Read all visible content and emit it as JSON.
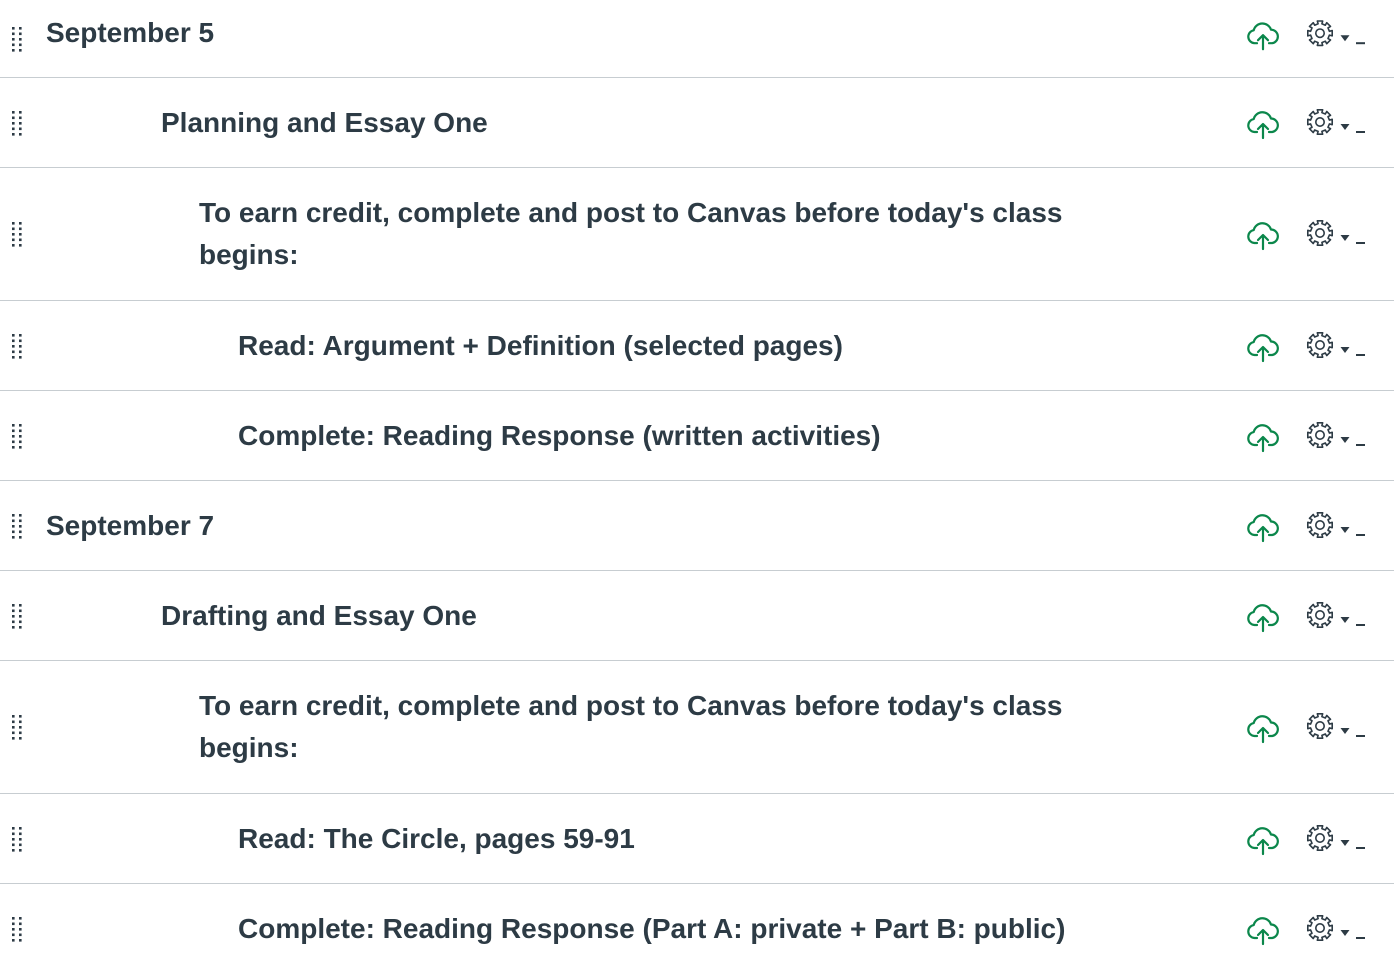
{
  "theme": {
    "text_color": "#2d3b45",
    "published_color": "#0b874b",
    "divider_color": "#c7cdd1"
  },
  "icons": {
    "handle": "drag-handle-icon",
    "publish": "cloud-upload-icon",
    "settings": "gear-icon",
    "menu": "caret-down-icon"
  },
  "items": [
    {
      "title": "September 5",
      "level": 0,
      "published": true
    },
    {
      "title": "Planning and Essay One",
      "level": 1,
      "published": true
    },
    {
      "title": "To earn credit, complete and post to Canvas before today's class begins:",
      "level": 2,
      "published": true
    },
    {
      "title": "Read: Argument + Definition (selected pages)",
      "level": 3,
      "published": true
    },
    {
      "title": "Complete: Reading Response (written activities)",
      "level": 3,
      "published": true
    },
    {
      "title": "September 7",
      "level": 0,
      "published": true
    },
    {
      "title": "Drafting and Essay One",
      "level": 1,
      "published": true
    },
    {
      "title": "To earn credit, complete and post to Canvas before today's class begins:",
      "level": 2,
      "published": true
    },
    {
      "title": "Read: The Circle, pages 59-91",
      "level": 3,
      "published": true
    },
    {
      "title": "Complete: Reading Response (Part A: private + Part B: public)",
      "level": 3,
      "published": true
    }
  ]
}
